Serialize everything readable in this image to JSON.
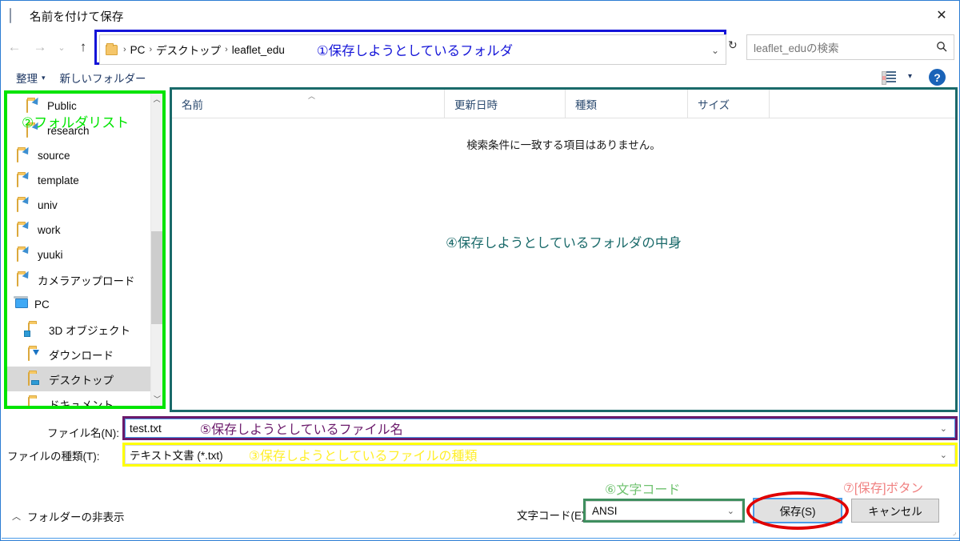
{
  "window": {
    "title": "名前を付けて保存",
    "title_icon": "notepad-icon",
    "close_label": "✕"
  },
  "nav": {
    "back": "←",
    "forward": "→",
    "recent": "⌄",
    "up": "↑",
    "refresh": "↻"
  },
  "address": {
    "crumbs": [
      "PC",
      "デスクトップ",
      "leaflet_edu"
    ],
    "separator": "›",
    "dropdown": "⌄",
    "annotation": "①保存しようとしているフォルダ",
    "annotation_color": "#1414d8"
  },
  "search": {
    "placeholder": "leaflet_eduの検索",
    "icon": "search-icon"
  },
  "commandbar": {
    "organize": "整理",
    "organize_caret": "▾",
    "new_folder": "新しいフォルダー",
    "view_caret": "▾",
    "help": "?"
  },
  "sidebar": {
    "annotation": "②フォルダリスト",
    "annotation_color": "#00e400",
    "scroll_up": "︿",
    "scroll_down": "﹀",
    "items": [
      {
        "label": "Public",
        "icon": "folder-shortcut-icon",
        "indent": 1,
        "selected": false
      },
      {
        "label": "research",
        "icon": "folder-shortcut-icon",
        "indent": 1,
        "selected": false
      },
      {
        "label": "source",
        "icon": "folder-shortcut-icon",
        "indent": 1,
        "selected": false
      },
      {
        "label": "template",
        "icon": "folder-shortcut-icon",
        "indent": 1,
        "selected": false
      },
      {
        "label": "univ",
        "icon": "folder-shortcut-icon",
        "indent": 1,
        "selected": false
      },
      {
        "label": "work",
        "icon": "folder-shortcut-icon",
        "indent": 1,
        "selected": false
      },
      {
        "label": "yuuki",
        "icon": "folder-shortcut-icon",
        "indent": 1,
        "selected": false
      },
      {
        "label": "カメラアップロード",
        "icon": "folder-shortcut-icon",
        "indent": 1,
        "selected": false
      },
      {
        "label": "PC",
        "icon": "pc-icon",
        "indent": 0,
        "selected": false
      },
      {
        "label": "3D オブジェクト",
        "icon": "folder-3d-icon",
        "indent": 1,
        "selected": false
      },
      {
        "label": "ダウンロード",
        "icon": "folder-download-icon",
        "indent": 1,
        "selected": false
      },
      {
        "label": "デスクトップ",
        "icon": "folder-desktop-icon",
        "indent": 1,
        "selected": true
      },
      {
        "label": "ドキュメント",
        "icon": "folder-documents-icon",
        "indent": 1,
        "selected": false
      }
    ]
  },
  "filelist": {
    "columns": [
      "名前",
      "更新日時",
      "種類",
      "サイズ"
    ],
    "sort_caret": "︿",
    "empty_message": "検索条件に一致する項目はありません。",
    "annotation": "④保存しようとしているフォルダの中身",
    "annotation_color": "#1a6a6a",
    "rows": []
  },
  "filename": {
    "label": "ファイル名(N):",
    "value": "test.txt",
    "dropdown": "⌄",
    "annotation": "⑤保存しようとしているファイル名",
    "annotation_color": "#6b1a6b"
  },
  "filetype": {
    "label": "ファイルの種類(T):",
    "value": "テキスト文書 (*.txt)",
    "dropdown": "⌄",
    "annotation": "③保存しようとしているファイルの種類",
    "annotation_color": "#ffef2a"
  },
  "encoding": {
    "label": "文字コード(E):",
    "value": "ANSI",
    "dropdown": "⌄",
    "annotation": "⑥文字コード",
    "annotation_color": "#6fc26f"
  },
  "actions": {
    "save_label": "保存(S)",
    "cancel_label": "キャンセル",
    "save_annotation": "⑦[保存]ボタン",
    "save_annotation_color": "#f08080"
  },
  "footer": {
    "hide_folders_caret": "︿",
    "hide_folders_label": "フォルダーの非表示",
    "grip": "◞"
  }
}
